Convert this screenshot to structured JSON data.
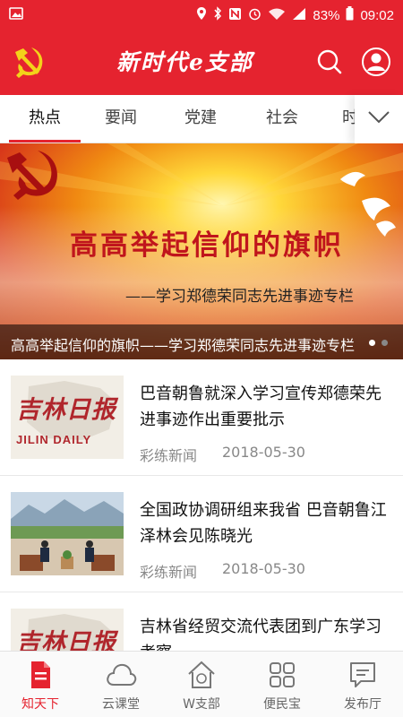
{
  "status_bar": {
    "battery": "83%",
    "time": "09:02",
    "icons": [
      "image-icon",
      "location-icon",
      "bluetooth-icon",
      "nfc-icon",
      "alarm-icon",
      "wifi-icon",
      "signal-icon",
      "battery-icon"
    ]
  },
  "header": {
    "title": "新时代e支部",
    "logo_icon": "party-emblem-icon",
    "search_icon": "search-icon",
    "user_icon": "user-icon"
  },
  "tabs": {
    "items": [
      {
        "label": "热点"
      },
      {
        "label": "要闻"
      },
      {
        "label": "党建"
      },
      {
        "label": "社会"
      },
      {
        "label": "时"
      }
    ],
    "active_index": 0,
    "more_icon": "chevron-down-icon"
  },
  "banner": {
    "headline": "高高举起信仰的旗帜",
    "subline": "——学习郑德荣同志先进事迹专栏",
    "caption": "高高举起信仰的旗帜——学习郑德荣同志先进事迹专栏"
  },
  "news": [
    {
      "title": "巴音朝鲁就深入学习宣传郑德荣先进事迹作出重要批示",
      "source": "彩练新闻",
      "date": "2018-05-30",
      "thumb": {
        "text_cn": "吉林日报",
        "text_en": "JILIN DAILY"
      }
    },
    {
      "title": "全国政协调研组来我省  巴音朝鲁江泽林会见陈晓光",
      "source": "彩练新闻",
      "date": "2018-05-30"
    },
    {
      "title": "吉林省经贸交流代表团到广东学习考察",
      "source": "",
      "date": "",
      "thumb": {
        "text_cn": "吉林日报",
        "text_en": ""
      }
    }
  ],
  "bottom_nav": {
    "items": [
      {
        "label": "知天下",
        "icon": "document-icon"
      },
      {
        "label": "云课堂",
        "icon": "cloud-icon"
      },
      {
        "label": "W支部",
        "icon": "home-party-icon"
      },
      {
        "label": "便民宝",
        "icon": "grid-icon"
      },
      {
        "label": "发布厅",
        "icon": "chat-icon"
      }
    ],
    "active_index": 0
  },
  "colors": {
    "brand_red": "#e5232f",
    "text_gray": "#888888"
  }
}
